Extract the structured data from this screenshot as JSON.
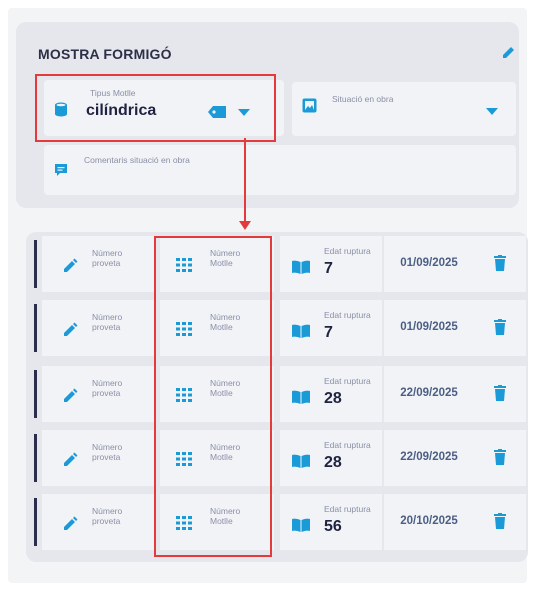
{
  "section": {
    "title": "MOSTRA FORMIGÓ"
  },
  "tipus_motlle": {
    "label": "Tipus Motlle",
    "value": "cilíndrica"
  },
  "situacio_obra": {
    "label": "Situació en obra",
    "value": ""
  },
  "comentaris": {
    "label": "Comentaris situació en obra"
  },
  "rows": [
    {
      "num_proveta_label": "Número proveta",
      "num_motlle_label": "Número Motlle",
      "edat_label": "Edat ruptura",
      "edat_value": "7",
      "date": "01/09/2025"
    },
    {
      "num_proveta_label": "Número proveta",
      "num_motlle_label": "Número Motlle",
      "edat_label": "Edat ruptura",
      "edat_value": "7",
      "date": "01/09/2025"
    },
    {
      "num_proveta_label": "Número proveta",
      "num_motlle_label": "Número Motlle",
      "edat_label": "Edat ruptura",
      "edat_value": "28",
      "date": "22/09/2025"
    },
    {
      "num_proveta_label": "Número proveta",
      "num_motlle_label": "Número Motlle",
      "edat_label": "Edat ruptura",
      "edat_value": "28",
      "date": "22/09/2025"
    },
    {
      "num_proveta_label": "Número proveta",
      "num_motlle_label": "Número Motlle",
      "edat_label": "Edat ruptura",
      "edat_value": "56",
      "date": "20/10/2025"
    }
  ],
  "icons": {
    "edit": "pencil-icon",
    "database": "database-icon",
    "tag": "tag-icon",
    "dropdown": "caret-down-icon",
    "situation": "image-frame-icon",
    "comment": "comment-icon",
    "grid": "grid-icon",
    "book": "book-icon",
    "delete": "trash-icon"
  },
  "colors": {
    "accent": "#1a9ad6",
    "highlight": "#e23b3b",
    "dark": "#2b2e48"
  }
}
